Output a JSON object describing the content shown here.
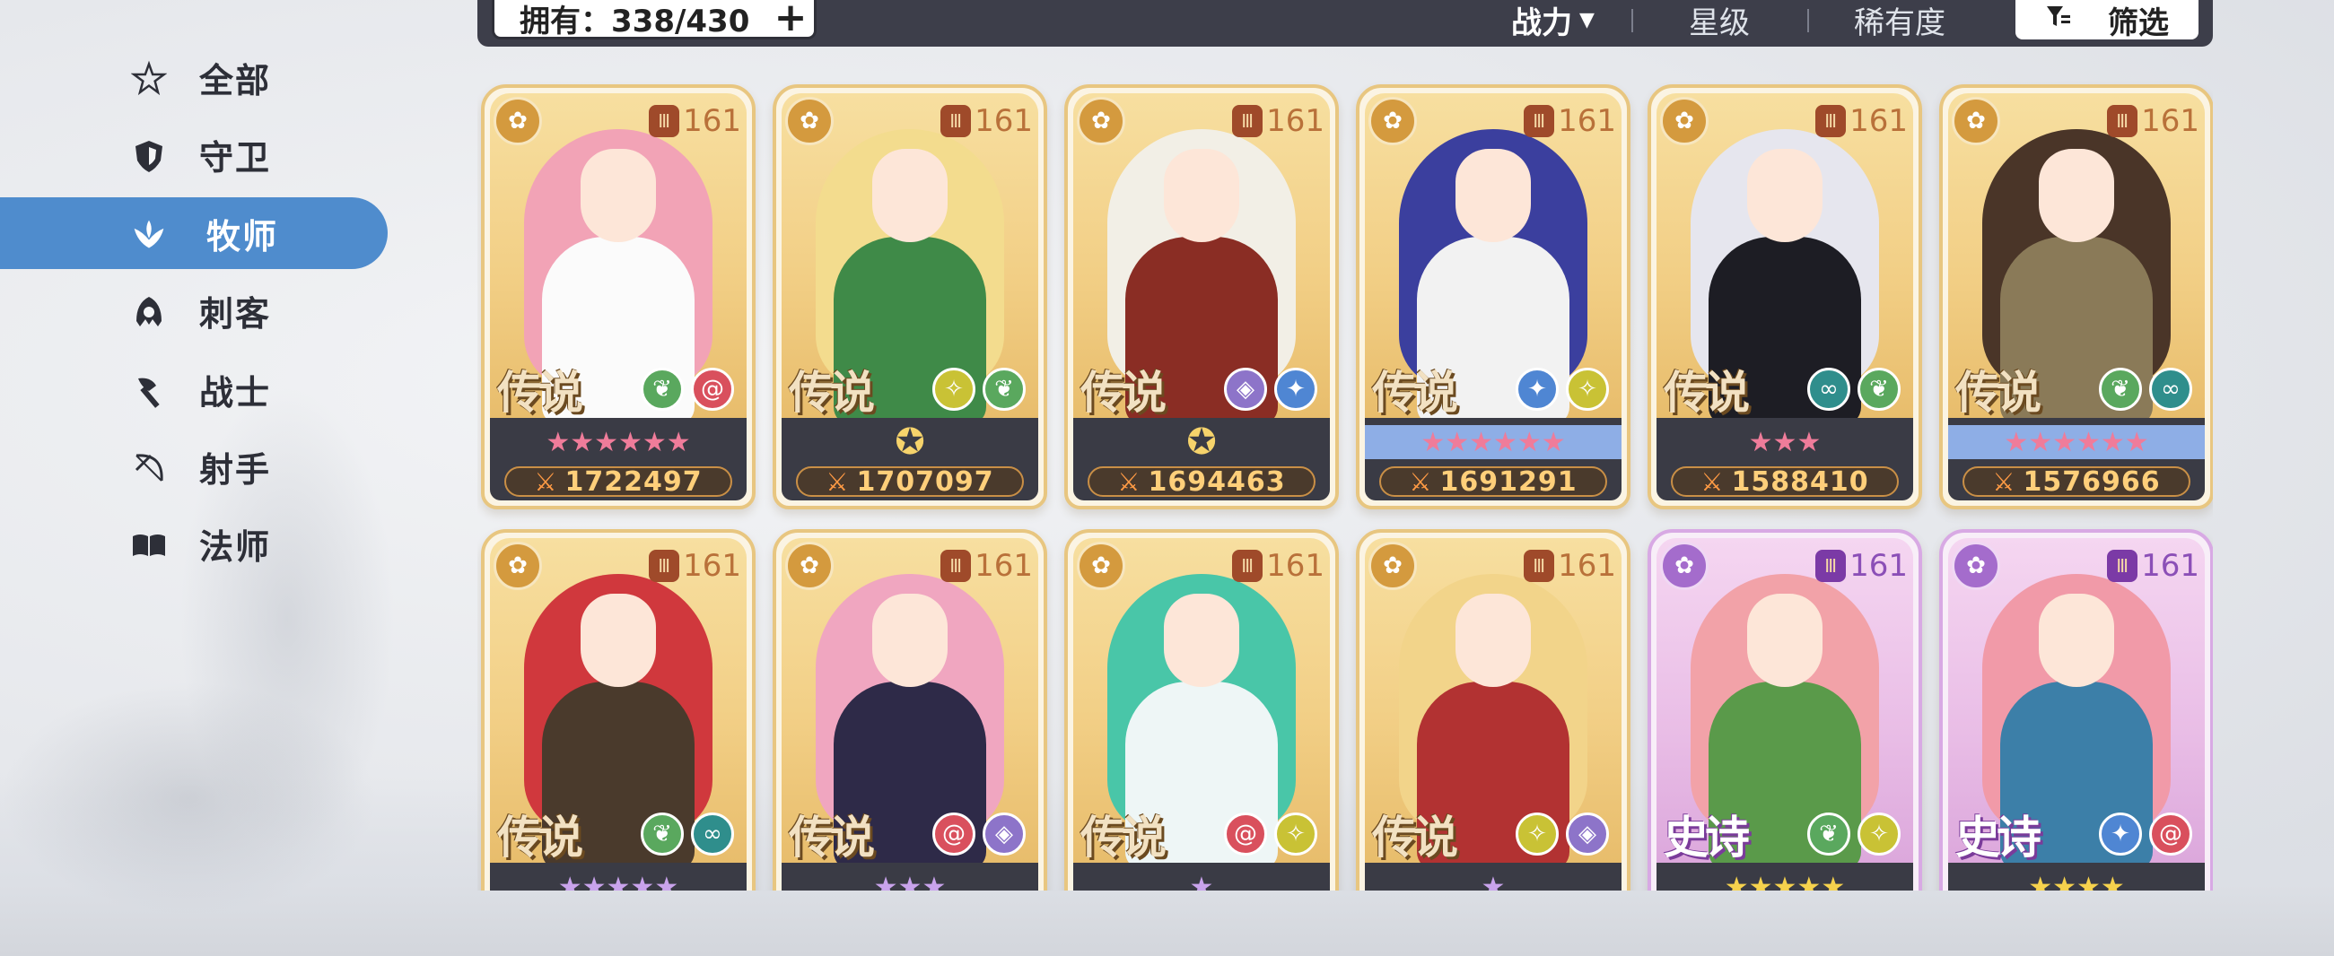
{
  "sidebar": {
    "items": [
      {
        "label": "全部",
        "icon": "all-star-icon",
        "active": false
      },
      {
        "label": "守卫",
        "icon": "shield-icon",
        "active": false
      },
      {
        "label": "牧师",
        "icon": "wing-leaf-icon",
        "active": true
      },
      {
        "label": "刺客",
        "icon": "hood-icon",
        "active": false
      },
      {
        "label": "战士",
        "icon": "axe-icon",
        "active": false
      },
      {
        "label": "射手",
        "icon": "bow-icon",
        "active": false
      },
      {
        "label": "法师",
        "icon": "book-icon",
        "active": false
      }
    ]
  },
  "topbar": {
    "owned_label": "拥有：338/430",
    "sort_power": "战力",
    "sort_star": "星级",
    "sort_rarity": "稀有度",
    "filter_label": "筛选"
  },
  "colors": {
    "accent": "#4f8ccd",
    "topbar_bg": "#3d3e4a",
    "legend_border": "#e8c680",
    "epic_border": "#d8a9e4"
  },
  "cards": [
    {
      "level": "161",
      "tier": "传说",
      "rarity": "legend",
      "elements": [
        "nature",
        "spiral"
      ],
      "stars": "★★★★★★",
      "star_style": "pink",
      "power": "1722497",
      "hair": "#f2a3b6",
      "outfit": "#fbfbfb"
    },
    {
      "level": "161",
      "tier": "传说",
      "rarity": "legend",
      "elements": [
        "wing",
        "nature"
      ],
      "stars": "✪",
      "star_style": "emblem",
      "power": "1707097",
      "hair": "#f3dc8e",
      "outfit": "#3f8a48"
    },
    {
      "level": "161",
      "tier": "传说",
      "rarity": "legend",
      "elements": [
        "eye",
        "star"
      ],
      "stars": "✪",
      "star_style": "emblem",
      "power": "1694463",
      "hair": "#f2efe6",
      "outfit": "#8a2d24"
    },
    {
      "level": "161",
      "tier": "传说",
      "rarity": "legend",
      "elements": [
        "star",
        "wing"
      ],
      "stars": "★★★★★★",
      "star_style": "banded",
      "power": "1691291",
      "hair": "#3b3f9e",
      "outfit": "#f2f2f2"
    },
    {
      "level": "161",
      "tier": "传说",
      "rarity": "legend",
      "elements": [
        "infinity",
        "nature"
      ],
      "stars": "★★★",
      "star_style": "pink",
      "power": "1588410",
      "hair": "#e6e6ee",
      "outfit": "#1d1d24"
    },
    {
      "level": "161",
      "tier": "传说",
      "rarity": "legend",
      "elements": [
        "nature",
        "infinity"
      ],
      "stars": "★★★★★★",
      "star_style": "banded",
      "power": "1576966",
      "hair": "#4a3528",
      "outfit": "#8a7a58"
    },
    {
      "level": "161",
      "tier": "传说",
      "rarity": "legend",
      "elements": [
        "nature",
        "infinity"
      ],
      "stars": "★★★★★",
      "star_style": "purple",
      "power": "",
      "hair": "#d0383d",
      "outfit": "#4a3a2c"
    },
    {
      "level": "161",
      "tier": "传说",
      "rarity": "legend",
      "elements": [
        "spiral",
        "eye"
      ],
      "stars": "★★★",
      "star_style": "purple",
      "power": "",
      "hair": "#f0a6c0",
      "outfit": "#2e2a48"
    },
    {
      "level": "161",
      "tier": "传说",
      "rarity": "legend",
      "elements": [
        "spiral",
        "wing"
      ],
      "stars": "★",
      "star_style": "purple",
      "power": "",
      "hair": "#49c6a8",
      "outfit": "#eef6f6"
    },
    {
      "level": "161",
      "tier": "传说",
      "rarity": "legend",
      "elements": [
        "wing",
        "eye"
      ],
      "stars": "★",
      "star_style": "purple",
      "power": "",
      "hair": "#f2d48a",
      "outfit": "#b23232"
    },
    {
      "level": "161",
      "tier": "史诗",
      "rarity": "epic",
      "elements": [
        "nature",
        "wing"
      ],
      "stars": "★★★★★",
      "star_style": "gold",
      "power": "",
      "hair": "#f2a2a8",
      "outfit": "#5a9a4a"
    },
    {
      "level": "161",
      "tier": "史诗",
      "rarity": "epic",
      "elements": [
        "star",
        "spiral"
      ],
      "stars": "★★★★",
      "star_style": "gold",
      "power": "",
      "hair": "#f19aa8",
      "outfit": "#3c7fa8"
    }
  ]
}
